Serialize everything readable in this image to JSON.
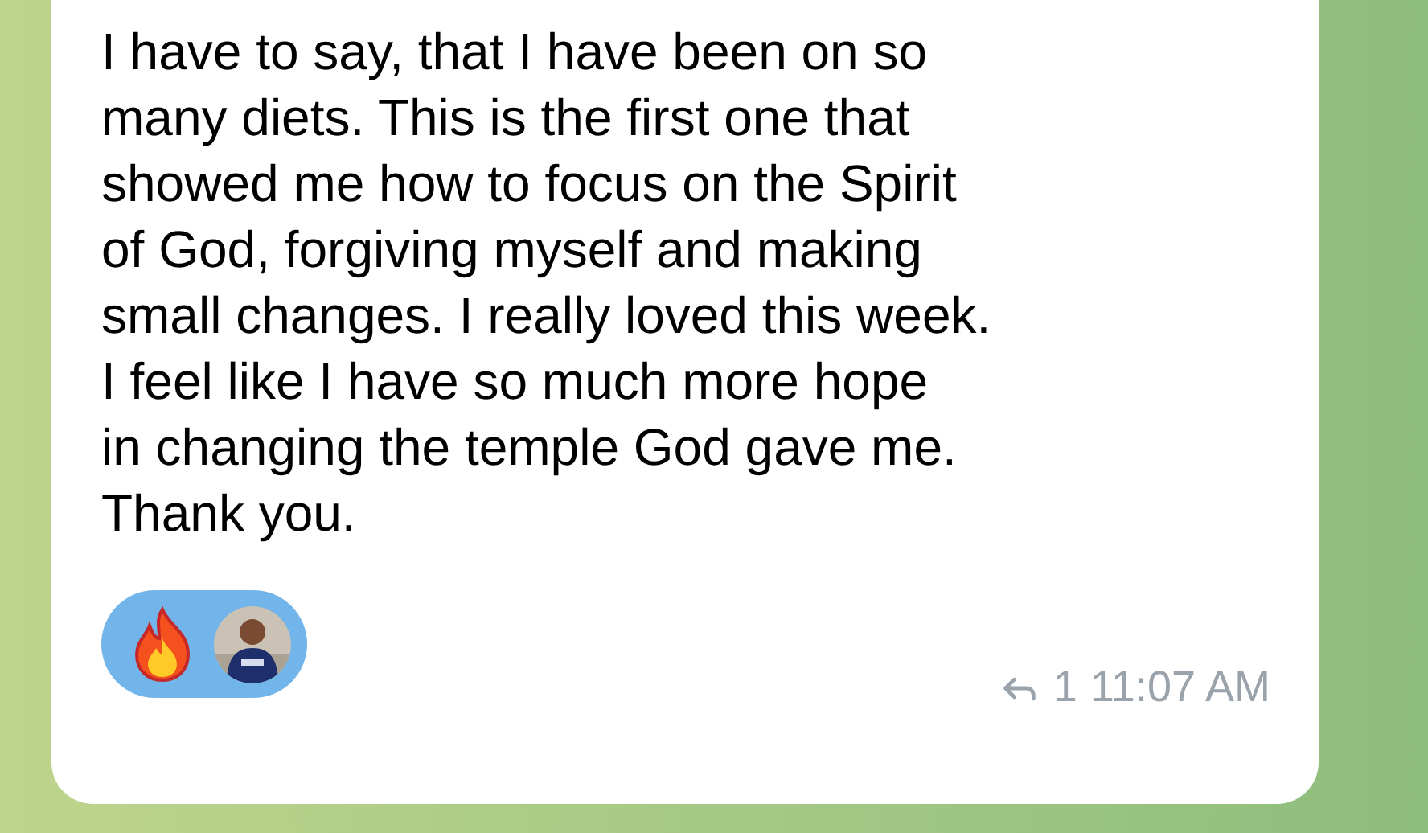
{
  "message": {
    "text": "I have to say, that I have been on so\nmany diets. This is the first one that\nshowed me how to focus on the Spirit\nof God, forgiving myself and making\nsmall changes. I really loved this week.\nI feel like I have so much more hope\nin changing the temple God gave me.\nThank you.",
    "reactions": [
      {
        "kind": "fire"
      },
      {
        "kind": "picture"
      }
    ],
    "replies": "1",
    "time": "11:07 AM"
  }
}
